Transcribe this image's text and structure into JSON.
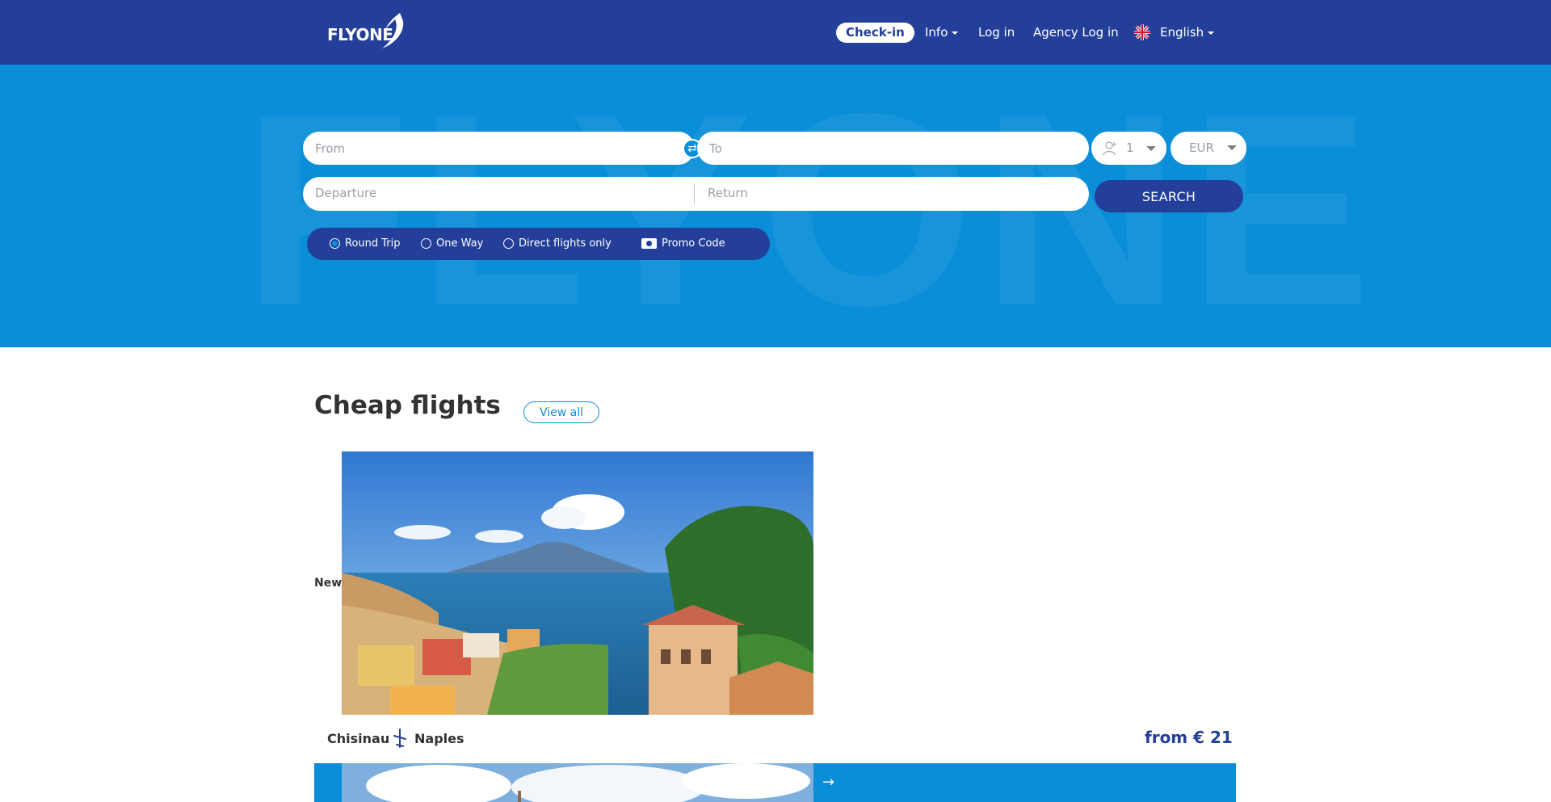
{
  "header": {
    "logo_text": "FLYONE",
    "nav": {
      "checkin": "Check-in",
      "info": "Info",
      "login": "Log in",
      "agency_login": "Agency Log in",
      "language": "English"
    }
  },
  "search": {
    "from_placeholder": "From",
    "to_placeholder": "To",
    "passengers": "1",
    "currency": "EUR",
    "departure_placeholder": "Departure",
    "return_placeholder": "Return",
    "search_label": "SEARCH",
    "options": {
      "round_trip": "Round Trip",
      "one_way": "One Way",
      "direct_only": "Direct flights only",
      "promo_code": "Promo Code"
    }
  },
  "cheap_flights": {
    "title": "Cheap flights",
    "view_all": "View all",
    "cards": [
      {
        "badge": "New",
        "from_city": "Chisinau",
        "to_city": "Naples",
        "price": "from € 21"
      }
    ]
  },
  "colors": {
    "header_bg": "#233f99",
    "hero_bg": "#0a8ed8",
    "button_bg": "#233f99"
  }
}
